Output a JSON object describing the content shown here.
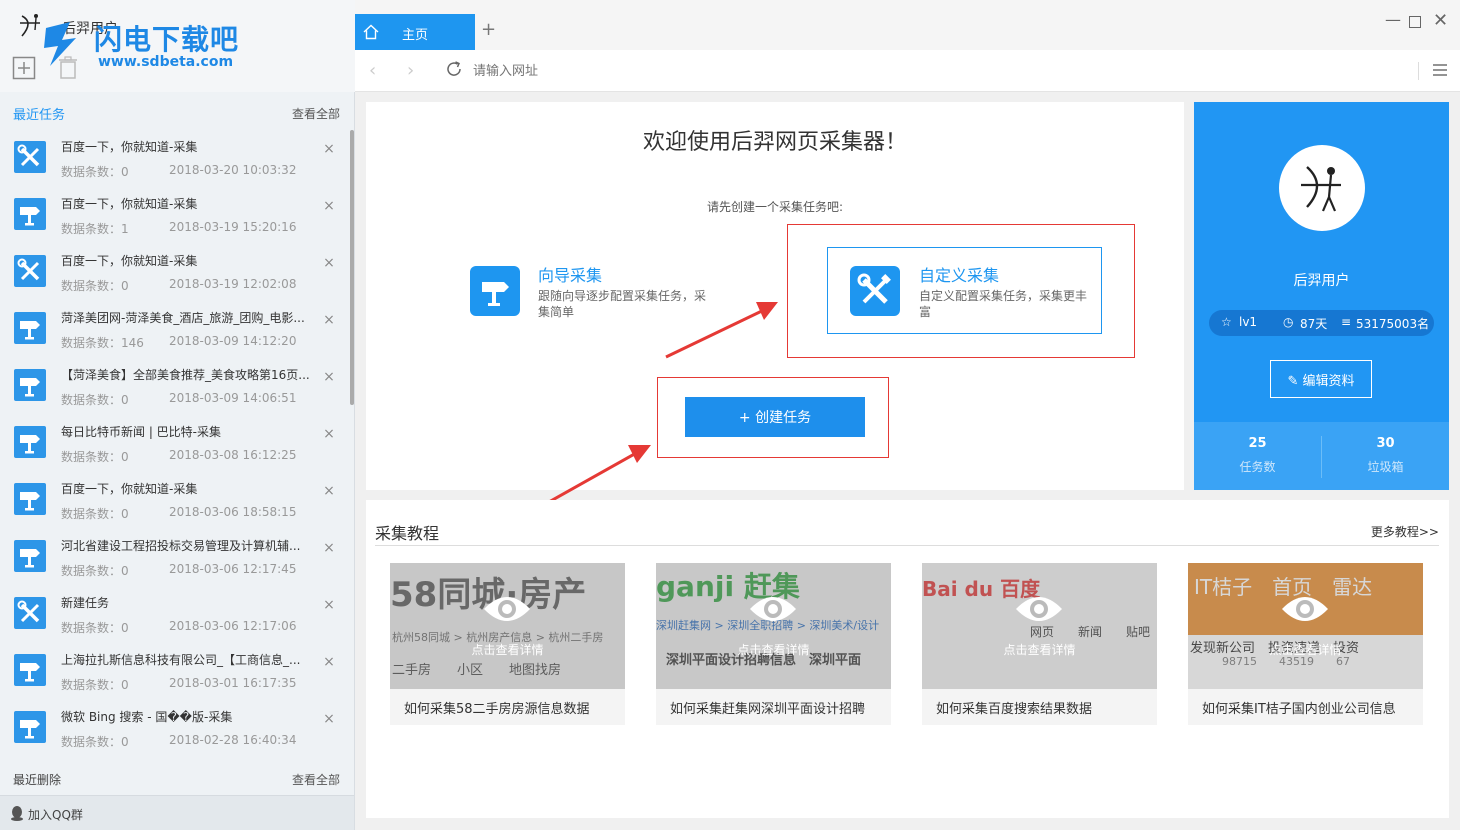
{
  "app": {
    "user_name": "后羿用户"
  },
  "watermark": {
    "brand": "闪电下载吧",
    "url": "www.sdbeta.com"
  },
  "sidebar": {
    "recent_title": "最近任务",
    "recent_view_all": "查看全部",
    "deleted_title": "最近删除",
    "deleted_view_all": "查看全部",
    "qq_group": "加入QQ群",
    "tasks": [
      {
        "title": "百度一下，你就知道-采集",
        "count": "数据条数：0",
        "time": "2018-03-20 10:03:32",
        "icon": "tools-icon"
      },
      {
        "title": "百度一下，你就知道-采集",
        "count": "数据条数：1",
        "time": "2018-03-19 15:20:16",
        "icon": "signpost-icon"
      },
      {
        "title": "百度一下，你就知道-采集",
        "count": "数据条数：0",
        "time": "2018-03-19 12:02:08",
        "icon": "tools-icon"
      },
      {
        "title": "菏泽美团网-菏泽美食_酒店_旅游_团购_电影...",
        "count": "数据条数：146",
        "time": "2018-03-09 14:12:20",
        "icon": "signpost-icon"
      },
      {
        "title": "【菏泽美食】全部美食推荐_美食攻略第16页...",
        "count": "数据条数：0",
        "time": "2018-03-09 14:06:51",
        "icon": "signpost-icon"
      },
      {
        "title": "每日比特币新闻 | 巴比特-采集",
        "count": "数据条数：0",
        "time": "2018-03-08 16:12:25",
        "icon": "signpost-icon"
      },
      {
        "title": "百度一下，你就知道-采集",
        "count": "数据条数：0",
        "time": "2018-03-06 18:58:15",
        "icon": "signpost-icon"
      },
      {
        "title": "河北省建设工程招投标交易管理及计算机辅...",
        "count": "数据条数：0",
        "time": "2018-03-06 12:17:45",
        "icon": "signpost-icon"
      },
      {
        "title": "新建任务",
        "count": "数据条数：0",
        "time": "2018-03-06 12:17:06",
        "icon": "tools-icon"
      },
      {
        "title": "上海拉扎斯信息科技有限公司_【工商信息_...",
        "count": "数据条数：0",
        "time": "2018-03-01 16:17:35",
        "icon": "signpost-icon"
      },
      {
        "title": "微软 Bing 搜索 - 国��版-采集",
        "count": "数据条数：0",
        "time": "2018-02-28 16:40:34",
        "icon": "signpost-icon"
      }
    ]
  },
  "tabs": {
    "home_label": "主页",
    "add_label": "+"
  },
  "address": {
    "placeholder": "请输入网址"
  },
  "welcome": {
    "title": "欢迎使用后羿网页采集器！",
    "subtitle": "请先创建一个采集任务吧:",
    "guide_title": "向导采集",
    "guide_desc": "跟随向导逐步配置采集任务，采集简单",
    "custom_title": "自定义采集",
    "custom_desc": "自定义配置采集任务，采集更丰富",
    "create_button": "+ 创建任务"
  },
  "profile": {
    "name": "后羿用户",
    "level": "lv1",
    "days": "87天",
    "rank": "53175003名",
    "edit_button": "编辑资料",
    "task_count": "25",
    "task_label": "任务数",
    "trash_count": "30",
    "trash_label": "垃圾箱"
  },
  "tutorials": {
    "title": "采集教程",
    "more": "更多教程>>",
    "hint": "点击查看详情",
    "cards": [
      {
        "caption": "如何采集58二手房房源信息数据",
        "thumb_main": "58同城·房产",
        "thumb_sub": "杭州58同城 > 杭州房产信息 > 杭州二手房",
        "thumb_tabs": "二手房　　小区　　地图找房"
      },
      {
        "caption": "如何采集赶集网深圳平面设计招聘",
        "thumb_main": "ganji 赶集",
        "thumb_sub": "深圳赶集网 > 深圳全职招聘 > 深圳美术/设计",
        "thumb_tabs": "深圳平面设计招聘信息　深圳平面"
      },
      {
        "caption": "如何采集百度搜索结果数据",
        "thumb_main": "Bai du 百度",
        "thumb_sub": "网页　　新闻　　贴吧",
        "thumb_tabs": ""
      },
      {
        "caption": "如何采集IT桔子国内创业公司信息",
        "thumb_main": "IT桔子　首页　雷达",
        "thumb_sub": "发现新公司　投资速递　投资",
        "thumb_tabs": "98715　　43519　　67"
      }
    ]
  },
  "colors": {
    "accent": "#1e96f0",
    "highlight_frame": "#e53935",
    "profile_bg": "#2196f3"
  }
}
